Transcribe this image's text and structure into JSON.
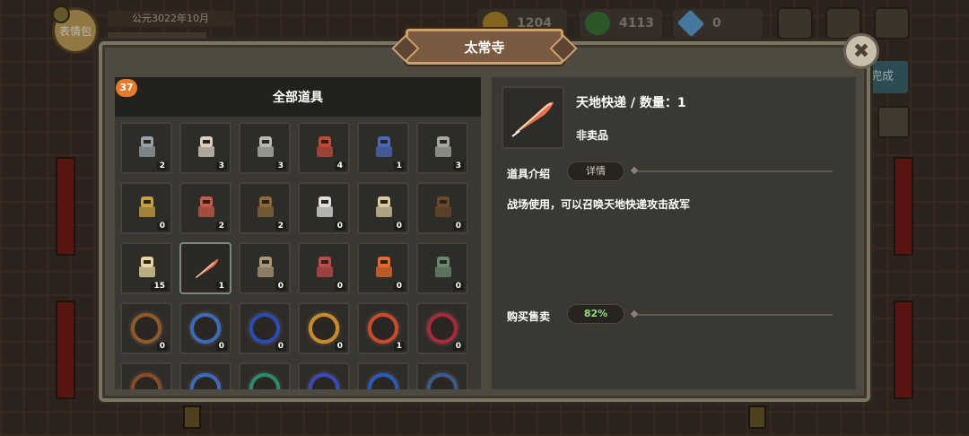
{
  "hud": {
    "avatar_label": "表情包",
    "date_text": "公元3022年10月",
    "resources": [
      {
        "name": "gold",
        "icon": "gold-coin-icon",
        "value": "1204",
        "color": "#b88b2a"
      },
      {
        "name": "clover",
        "icon": "clover-icon",
        "value": "4113",
        "color": "#3e7a3a"
      },
      {
        "name": "diamond",
        "icon": "diamond-icon",
        "value": "0",
        "color": "#5fa7d8"
      }
    ]
  },
  "side": {
    "done_label": "完成"
  },
  "panel": {
    "title": "太常寺",
    "close_label": "✖"
  },
  "inventory": {
    "header": "全部道具",
    "count": "37",
    "items": [
      {
        "name": "soldier-helmet",
        "qty": "2",
        "color": "#9aa0a8"
      },
      {
        "name": "bearded-general",
        "qty": "3",
        "color": "#d9d0c0"
      },
      {
        "name": "armored-knight",
        "qty": "3",
        "color": "#b8b8b0"
      },
      {
        "name": "spear-soldier",
        "qty": "4",
        "color": "#c04a3a"
      },
      {
        "name": "shield-soldier",
        "qty": "1",
        "color": "#4a6ab8"
      },
      {
        "name": "heavy-infantry",
        "qty": "3",
        "color": "#a8a8a0"
      },
      {
        "name": "gold-archer",
        "qty": "0",
        "color": "#c9a040"
      },
      {
        "name": "red-warrior",
        "qty": "2",
        "color": "#c85a4a"
      },
      {
        "name": "shaman",
        "qty": "2",
        "color": "#8a6a3a"
      },
      {
        "name": "cavalry",
        "qty": "0",
        "color": "#e0e0d8"
      },
      {
        "name": "mounted-scholar",
        "qty": "0",
        "color": "#d8c8a0"
      },
      {
        "name": "siege-cart",
        "qty": "0",
        "color": "#6a4a2a"
      },
      {
        "name": "map-scroll",
        "qty": "15",
        "color": "#e8d8a0"
      },
      {
        "name": "heaven-earth-express",
        "qty": "1",
        "color": "#e87050",
        "selected": true
      },
      {
        "name": "stone-brain",
        "qty": "0",
        "color": "#a89878"
      },
      {
        "name": "weapon-set",
        "qty": "0",
        "color": "#c04a4a"
      },
      {
        "name": "fire-brazier",
        "qty": "0",
        "color": "#e86a2a"
      },
      {
        "name": "treasure-chest",
        "qty": "0",
        "color": "#6a8a70"
      },
      {
        "name": "golden-orb",
        "qty": "0",
        "color": "#8a5a2a"
      },
      {
        "name": "wind-orb",
        "qty": "0",
        "color": "#3a6ab8"
      },
      {
        "name": "vortex-orb",
        "qty": "0",
        "color": "#2a4ab8"
      },
      {
        "name": "golden-crown-orb",
        "qty": "0",
        "color": "#c88a2a"
      },
      {
        "name": "fire-slash-orb",
        "qty": "1",
        "color": "#c84a2a"
      },
      {
        "name": "crimson-arc-orb",
        "qty": "0",
        "color": "#a82a3a"
      },
      {
        "name": "orb-partial-1",
        "qty": "",
        "color": "#8a4a2a"
      },
      {
        "name": "orb-partial-2",
        "qty": "",
        "color": "#3a6ab8"
      },
      {
        "name": "orb-partial-3",
        "qty": "",
        "color": "#2a8a6a"
      },
      {
        "name": "orb-partial-4",
        "qty": "",
        "color": "#3a4ab8"
      },
      {
        "name": "orb-partial-5",
        "qty": "",
        "color": "#2a5ab8"
      },
      {
        "name": "orb-partial-6",
        "qty": "",
        "color": "#3a5a8a"
      }
    ]
  },
  "detail": {
    "item_name": "天地快递 / 数量：1",
    "tag": "非卖品",
    "intro_label": "道具介绍",
    "intro_pill": "详情",
    "description": "战场使用，可以召唤天地快递攻击敌军",
    "trade_label": "购买售卖",
    "trade_pill": "82%"
  }
}
